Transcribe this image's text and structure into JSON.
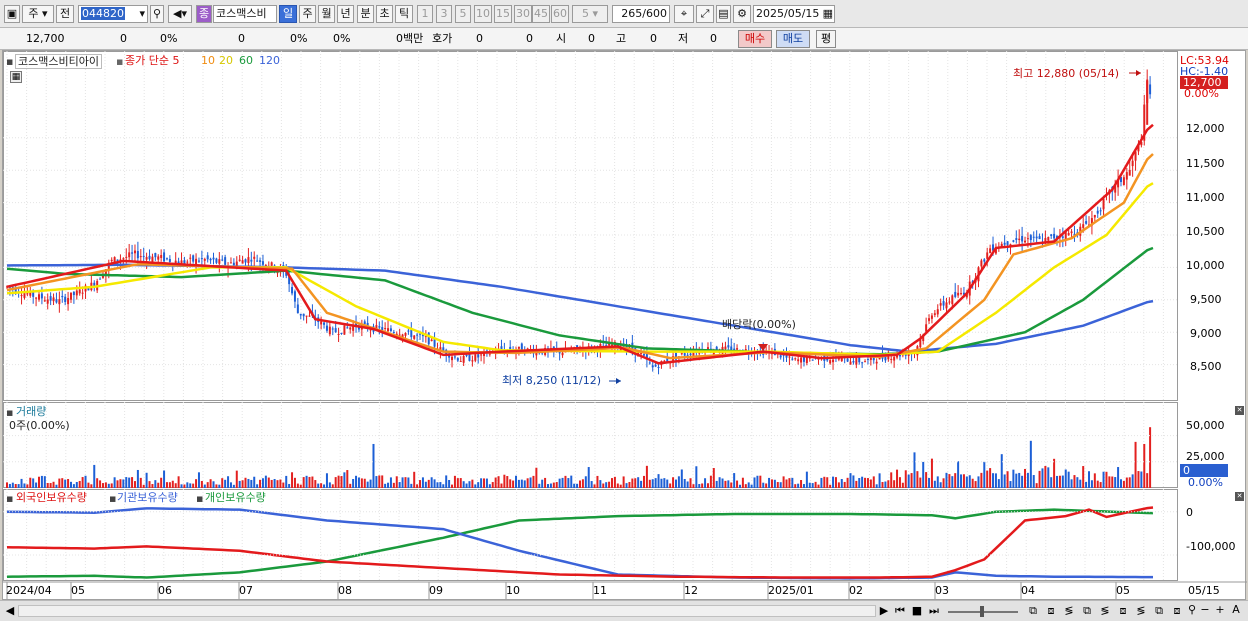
{
  "toolbar": {
    "market": "주",
    "prev": "전",
    "code": "044820",
    "badge": "종",
    "name": "코스맥스비",
    "periods": [
      "일",
      "주",
      "월",
      "년",
      "분",
      "초",
      "틱"
    ],
    "active_period": "일",
    "intervals": [
      "1",
      "3",
      "5",
      "10",
      "15",
      "30",
      "45",
      "60"
    ],
    "interval_value": "5",
    "count": "265",
    "count_total": "/600",
    "date": "2025/05/15"
  },
  "quote": {
    "price": "12,700",
    "change": "0",
    "change_pct": "0%",
    "vol": "0",
    "vol_pct": "0%",
    "vol_pct2": "0%",
    "amount": "0백만",
    "hoga_label": "호가",
    "hoga1": "0",
    "hoga2": "0",
    "open_label": "시",
    "open": "0",
    "high_label": "고",
    "high": "0",
    "low_label": "저",
    "low": "0",
    "buy": "매수",
    "sell": "매도",
    "eval": "평"
  },
  "bottom": {
    "x_labels": [
      "2024/04",
      "05",
      "06",
      "07",
      "08",
      "09",
      "10",
      "11",
      "12",
      "2025/01",
      "02",
      "03",
      "04",
      "05"
    ],
    "right_date": "05/15"
  },
  "colors": {
    "up": "#e3201f",
    "down": "#1c5fd6",
    "ma5": "#e31a1c",
    "ma10": "#f39422",
    "ma20": "#f5e900",
    "ma60": "#1a9a3c",
    "ma120": "#3b63d8"
  },
  "chart_data": [
    {
      "type": "line",
      "title": "코스맥스비티아이",
      "legend": [
        {
          "name": "종가 단순 5",
          "color": "#e31a1c"
        },
        {
          "name": "10",
          "color": "#f39422"
        },
        {
          "name": "20",
          "color": "#e6d800"
        },
        {
          "name": "60",
          "color": "#1a9a3c"
        },
        {
          "name": "120",
          "color": "#3b63d8"
        }
      ],
      "x": [
        "2024/04",
        "05",
        "06",
        "07",
        "08",
        "09",
        "10",
        "11",
        "12",
        "2025/01",
        "02",
        "03",
        "04",
        "05"
      ],
      "y_ticks": [
        "12,000",
        "11,500",
        "11,000",
        "10,500",
        "10,000",
        "9,500",
        "9,000",
        "8,500"
      ],
      "ylim": [
        8000,
        13000
      ],
      "price_points": [
        [
          0,
          9700
        ],
        [
          10,
          9550
        ],
        [
          18,
          9480
        ],
        [
          24,
          9600
        ],
        [
          30,
          9750
        ],
        [
          36,
          10100
        ],
        [
          44,
          10200
        ],
        [
          52,
          10150
        ],
        [
          60,
          10080
        ],
        [
          68,
          10120
        ],
        [
          76,
          10050
        ],
        [
          84,
          10150
        ],
        [
          90,
          10050
        ],
        [
          96,
          9900
        ],
        [
          100,
          9300
        ],
        [
          106,
          9200
        ],
        [
          112,
          9000
        ],
        [
          120,
          9100
        ],
        [
          128,
          9050
        ],
        [
          136,
          9000
        ],
        [
          144,
          8900
        ],
        [
          150,
          8700
        ],
        [
          156,
          8580
        ],
        [
          162,
          8620
        ],
        [
          168,
          8720
        ],
        [
          176,
          8730
        ],
        [
          184,
          8710
        ],
        [
          192,
          8700
        ],
        [
          200,
          8750
        ],
        [
          206,
          8800
        ],
        [
          212,
          8800
        ],
        [
          218,
          8650
        ],
        [
          222,
          8450
        ],
        [
          226,
          8550
        ],
        [
          232,
          8650
        ],
        [
          240,
          8750
        ],
        [
          248,
          8730
        ],
        [
          256,
          8720
        ],
        [
          264,
          8680
        ],
        [
          270,
          8560
        ],
        [
          278,
          8600
        ],
        [
          286,
          8600
        ],
        [
          294,
          8550
        ],
        [
          300,
          8600
        ],
        [
          306,
          8650
        ],
        [
          312,
          8700
        ],
        [
          318,
          9300
        ],
        [
          324,
          9500
        ],
        [
          330,
          9650
        ],
        [
          338,
          10300
        ],
        [
          344,
          10400
        ],
        [
          350,
          10450
        ],
        [
          356,
          10400
        ],
        [
          362,
          10500
        ],
        [
          368,
          10550
        ],
        [
          374,
          10800
        ],
        [
          380,
          11200
        ],
        [
          386,
          11500
        ],
        [
          390,
          12000
        ],
        [
          392,
          12880
        ],
        [
          393,
          12700
        ]
      ],
      "ma5": [
        [
          0,
          9700
        ],
        [
          40,
          10100
        ],
        [
          96,
          9950
        ],
        [
          106,
          9200
        ],
        [
          126,
          9050
        ],
        [
          150,
          8650
        ],
        [
          170,
          8700
        ],
        [
          210,
          8780
        ],
        [
          224,
          8520
        ],
        [
          260,
          8700
        ],
        [
          280,
          8600
        ],
        [
          306,
          8650
        ],
        [
          314,
          8900
        ],
        [
          330,
          9600
        ],
        [
          340,
          10300
        ],
        [
          360,
          10400
        ],
        [
          380,
          11200
        ],
        [
          393,
          12200
        ]
      ],
      "ma10": [
        [
          0,
          9650
        ],
        [
          45,
          10050
        ],
        [
          98,
          9980
        ],
        [
          110,
          9300
        ],
        [
          150,
          8700
        ],
        [
          175,
          8680
        ],
        [
          212,
          8760
        ],
        [
          228,
          8600
        ],
        [
          262,
          8690
        ],
        [
          300,
          8620
        ],
        [
          316,
          8750
        ],
        [
          336,
          9500
        ],
        [
          346,
          10200
        ],
        [
          366,
          10450
        ],
        [
          384,
          11000
        ],
        [
          393,
          11750
        ]
      ],
      "ma20": [
        [
          0,
          9600
        ],
        [
          30,
          9700
        ],
        [
          70,
          10000
        ],
        [
          96,
          10000
        ],
        [
          120,
          9400
        ],
        [
          150,
          8850
        ],
        [
          170,
          8720
        ],
        [
          220,
          8700
        ],
        [
          262,
          8700
        ],
        [
          300,
          8650
        ],
        [
          320,
          8700
        ],
        [
          340,
          9300
        ],
        [
          360,
          10000
        ],
        [
          378,
          10500
        ],
        [
          393,
          11300
        ]
      ],
      "ma60": [
        [
          0,
          9980
        ],
        [
          20,
          9900
        ],
        [
          60,
          9850
        ],
        [
          96,
          9950
        ],
        [
          130,
          9800
        ],
        [
          160,
          9300
        ],
        [
          190,
          8950
        ],
        [
          220,
          8750
        ],
        [
          270,
          8680
        ],
        [
          300,
          8660
        ],
        [
          320,
          8700
        ],
        [
          350,
          9000
        ],
        [
          370,
          9500
        ],
        [
          393,
          10300
        ]
      ],
      "ma120": [
        [
          0,
          10030
        ],
        [
          40,
          10040
        ],
        [
          96,
          10000
        ],
        [
          130,
          9950
        ],
        [
          170,
          9700
        ],
        [
          210,
          9400
        ],
        [
          250,
          9100
        ],
        [
          290,
          8800
        ],
        [
          310,
          8700
        ],
        [
          340,
          8820
        ],
        [
          370,
          9100
        ],
        [
          393,
          9480
        ]
      ],
      "annotations": [
        "최고 12,880 (05/14)",
        "최저 8,250 (11/12)",
        "배당락(0.00%)"
      ],
      "right_labels": [
        "LC:53.94",
        "HC:-1.40",
        "12,700",
        "0.00%"
      ]
    },
    {
      "type": "bar",
      "title": "거래량",
      "subtitle": "0주(0.00%)",
      "y_ticks": [
        "50,000",
        "25,000",
        "0"
      ],
      "ylim": [
        0,
        62000
      ],
      "right_labels": [
        "0",
        "0.00%"
      ],
      "spikes": [
        [
          30,
          22000
        ],
        [
          98,
          15000
        ],
        [
          126,
          42000
        ],
        [
          200,
          20000
        ],
        [
          300,
          14000
        ],
        [
          312,
          34000
        ],
        [
          318,
          28000
        ],
        [
          338,
          19000
        ],
        [
          352,
          45000
        ],
        [
          372,
          16000
        ],
        [
          382,
          20000
        ],
        [
          388,
          44000
        ],
        [
          391,
          42000
        ],
        [
          393,
          58000
        ]
      ]
    },
    {
      "type": "line",
      "legend": [
        {
          "name": "외국인보유수량",
          "color": "#e31a1c"
        },
        {
          "name": "기관보유수량",
          "color": "#3b63d8"
        },
        {
          "name": "개인보유수량",
          "color": "#1a9a3c"
        }
      ],
      "y_ticks": [
        "0",
        "-100,000"
      ],
      "ylim": [
        -160000,
        25000
      ],
      "foreign": [
        [
          0,
          -82000
        ],
        [
          30,
          -85000
        ],
        [
          48,
          -80000
        ],
        [
          80,
          -90000
        ],
        [
          110,
          -115000
        ],
        [
          150,
          -130000
        ],
        [
          190,
          -145000
        ],
        [
          230,
          -150000
        ],
        [
          270,
          -152000
        ],
        [
          300,
          -152000
        ],
        [
          318,
          -150000
        ],
        [
          326,
          -135000
        ],
        [
          336,
          -110000
        ],
        [
          350,
          -20000
        ],
        [
          364,
          -10000
        ],
        [
          372,
          5000
        ],
        [
          378,
          -12000
        ],
        [
          386,
          0
        ],
        [
          393,
          10000
        ]
      ],
      "institution": [
        [
          0,
          0
        ],
        [
          30,
          -2000
        ],
        [
          48,
          8000
        ],
        [
          80,
          5000
        ],
        [
          110,
          -20000
        ],
        [
          150,
          -40000
        ],
        [
          176,
          -90000
        ],
        [
          210,
          -145000
        ],
        [
          250,
          -152000
        ],
        [
          290,
          -154000
        ],
        [
          318,
          -152000
        ],
        [
          326,
          -140000
        ],
        [
          340,
          -148000
        ],
        [
          360,
          -150000
        ],
        [
          393,
          -151000
        ]
      ],
      "retail": [
        [
          0,
          -150000
        ],
        [
          30,
          -148000
        ],
        [
          48,
          -152000
        ],
        [
          80,
          -140000
        ],
        [
          110,
          -115000
        ],
        [
          150,
          -60000
        ],
        [
          176,
          -20000
        ],
        [
          210,
          -10000
        ],
        [
          250,
          -5000
        ],
        [
          290,
          -5000
        ],
        [
          318,
          -8000
        ],
        [
          326,
          -15000
        ],
        [
          340,
          0
        ],
        [
          360,
          5000
        ],
        [
          393,
          -3000
        ]
      ]
    }
  ]
}
